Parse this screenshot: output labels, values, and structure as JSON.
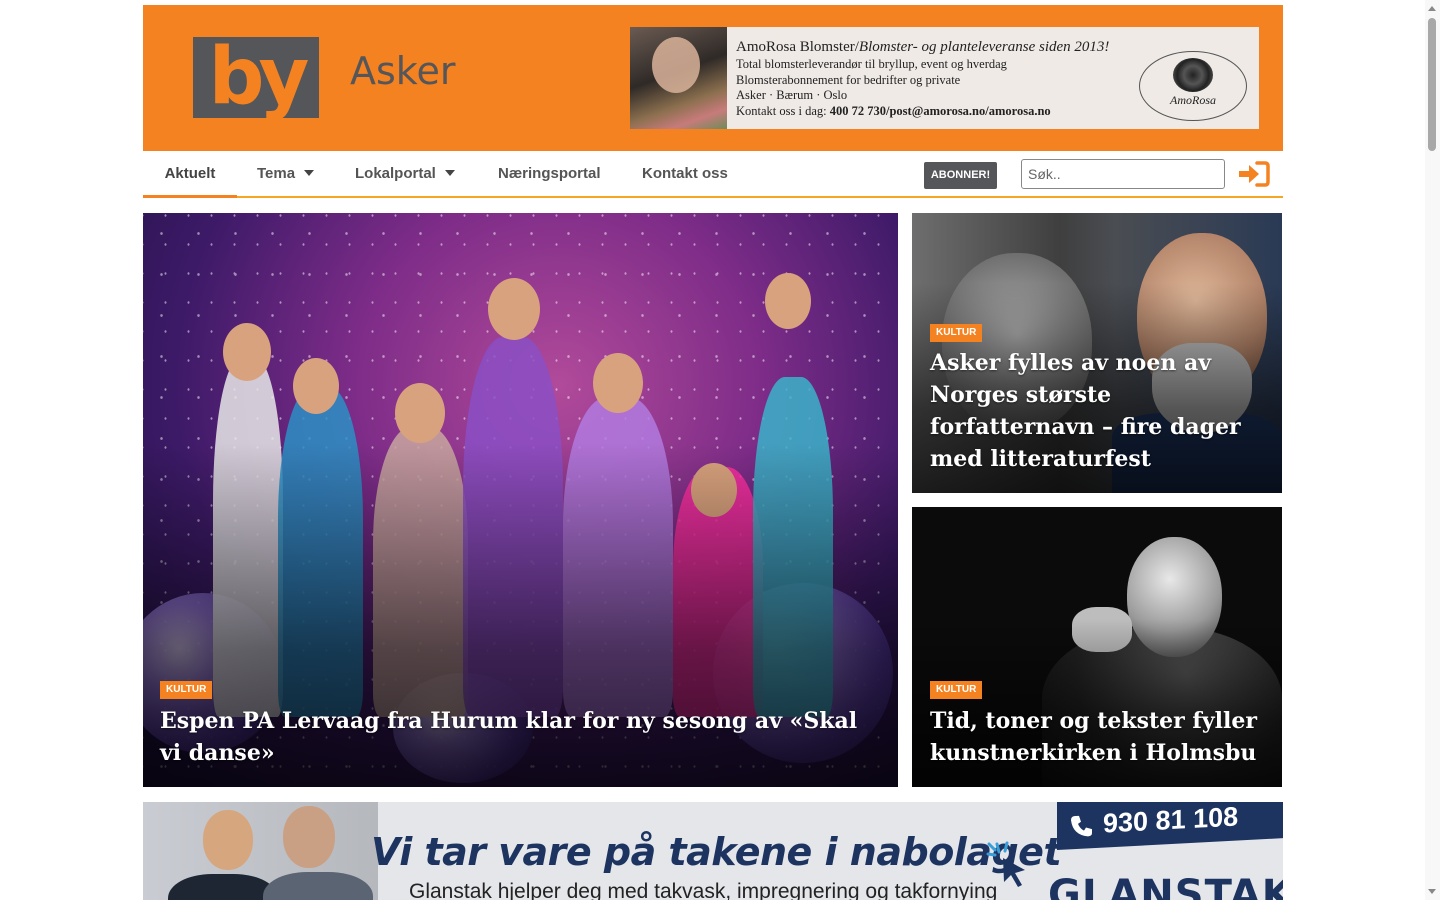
{
  "header": {
    "logo_text": "by",
    "city": "Asker",
    "ad": {
      "line1_a": "AmoRosa Blomster/",
      "line1_b": "Blomster- og planteleveranse siden 2013!",
      "line2": "Total blomsterleverandør til bryllup, event og hverdag",
      "line3": "Blomsterabonnement for bedrifter og private",
      "line4": "Asker · Bærum · Oslo",
      "line5_a": "Kontakt oss i dag: ",
      "line5_b": "400 72 730/post@amorosa.no/amorosa.no",
      "logo_text": "AmoRosa"
    }
  },
  "nav": {
    "items": [
      {
        "label": "Aktuelt",
        "active": true
      },
      {
        "label": "Tema",
        "dropdown": true
      },
      {
        "label": "Lokalportal",
        "dropdown": true
      },
      {
        "label": "Næringsportal"
      },
      {
        "label": "Kontakt oss"
      }
    ],
    "subscribe_label": "ABONNER!",
    "search_placeholder": "Søk..",
    "login_icon": "sign-in-icon"
  },
  "articles": {
    "main": {
      "category": "KULTUR",
      "title": "Espen PA Lervaag fra Hurum klar for ny sesong av «Skal vi danse»"
    },
    "right_top": {
      "category": "KULTUR",
      "title": "Asker fylles av noen av Norges største forfatternavn – fire dager med litteraturfest"
    },
    "right_bottom": {
      "category": "KULTUR",
      "title": "Tid, toner og tekster fyller kunstnerkirken i Holmsbu"
    }
  },
  "bottom_ad": {
    "slogan": "Vi tar vare på takene i nabolaget",
    "subline": "Glanstak hjelper deg med takvask, impregnering og takfornying",
    "phone": "930 81 108",
    "brand": "GLANSTAK"
  },
  "colors": {
    "brand_orange": "#f58220",
    "logo_grey": "#55565a",
    "ad_navy": "#1d3461"
  }
}
